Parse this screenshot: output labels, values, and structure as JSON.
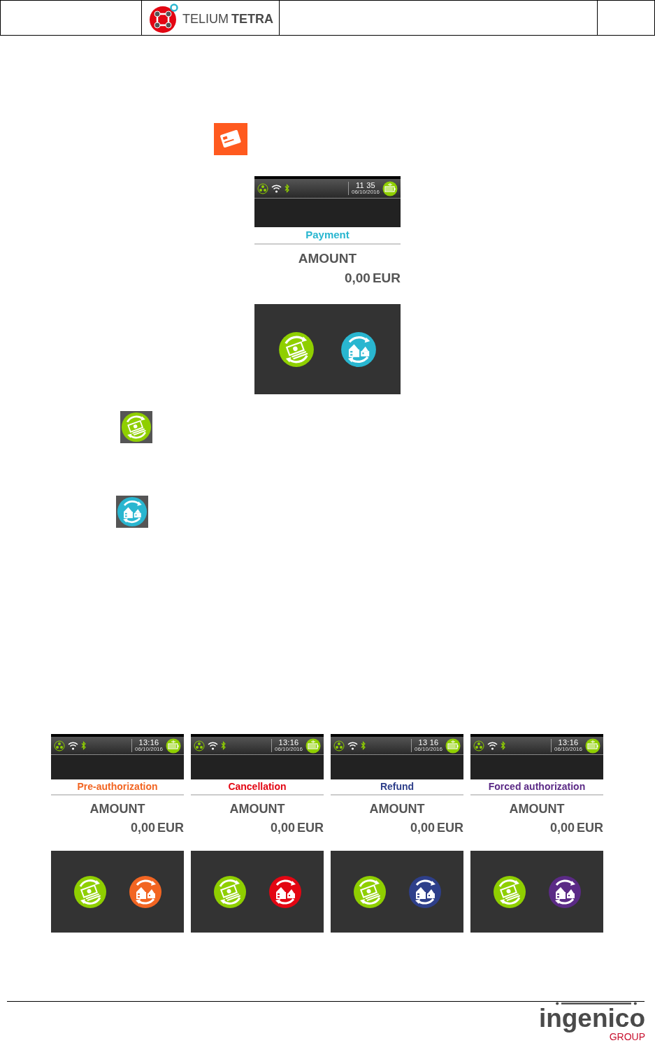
{
  "header": {
    "logo_light": "TELIUM",
    "logo_bold": "TETRA"
  },
  "main_screen": {
    "time": "11 35",
    "date": "06/10/2016",
    "title": "Payment",
    "color": "#29b6d0",
    "amount_label": "AMOUNT",
    "amount": "0,00",
    "currency": "EUR"
  },
  "screens": [
    {
      "time": "13:16",
      "date": "06/10/2016",
      "title": "Pre-authorization",
      "color": "#f26522",
      "amount_label": "AMOUNT",
      "amount": "0,00",
      "currency": "EUR"
    },
    {
      "time": "13:16",
      "date": "06/10/2016",
      "title": "Cancellation",
      "color": "#e30613",
      "amount_label": "AMOUNT",
      "amount": "0,00",
      "currency": "EUR"
    },
    {
      "time": "13 16",
      "date": "06/10/2016",
      "title": "Refund",
      "color": "#2e3f8a",
      "amount_label": "AMOUNT",
      "amount": "0,00",
      "currency": "EUR"
    },
    {
      "time": "13:16",
      "date": "06/10/2016",
      "title": "Forced authorization",
      "color": "#5b2a86",
      "amount_label": "AMOUNT",
      "amount": "0,00",
      "currency": "EUR"
    }
  ],
  "footer": {
    "brand": "ingenico",
    "group": "GROUP"
  }
}
